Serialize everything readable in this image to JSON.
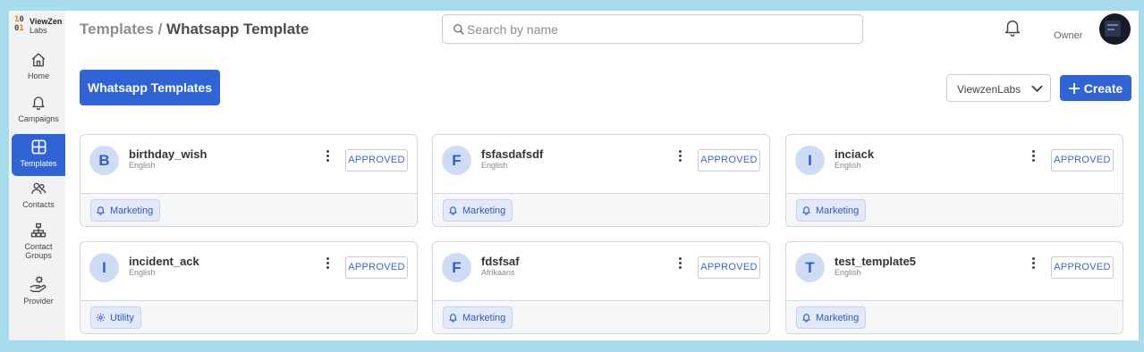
{
  "brand": {
    "name_line1": "ViewZen",
    "name_line2": "Labs"
  },
  "sidebar": {
    "items": [
      {
        "label": "Home",
        "icon": "home-icon"
      },
      {
        "label": "Campaigns",
        "icon": "bell-icon"
      },
      {
        "label": "Templates",
        "icon": "grid-icon",
        "active": true
      },
      {
        "label": "Contacts",
        "icon": "users-icon"
      },
      {
        "label": "Contact Groups",
        "icon": "hierarchy-icon"
      },
      {
        "label": "Provider",
        "icon": "hand-gear-icon"
      }
    ]
  },
  "header": {
    "breadcrumb_parent": "Templates",
    "breadcrumb_sep": "/",
    "breadcrumb_current": "Whatsapp Template",
    "search_placeholder": "Search by name",
    "user_role": "Owner"
  },
  "toolbar": {
    "whatsapp_templates_label": "Whatsapp Templates",
    "org_selected": "ViewzenLabs",
    "create_label": "Create"
  },
  "colors": {
    "accent": "#2f63d6",
    "status_text": "#3d66c8",
    "badge_bg": "#e2eaf9"
  },
  "templates": [
    {
      "initial": "B",
      "name": "birthday_wish",
      "language": "English",
      "status": "APPROVED",
      "category": "Marketing",
      "category_icon": "bell-icon"
    },
    {
      "initial": "F",
      "name": "fsfasdafsdf",
      "language": "English",
      "status": "APPROVED",
      "category": "Marketing",
      "category_icon": "bell-icon"
    },
    {
      "initial": "I",
      "name": "inciack",
      "language": "English",
      "status": "APPROVED",
      "category": "Marketing",
      "category_icon": "bell-icon"
    },
    {
      "initial": "I",
      "name": "incident_ack",
      "language": "English",
      "status": "APPROVED",
      "category": "Utility",
      "category_icon": "gear-icon"
    },
    {
      "initial": "F",
      "name": "fdsfsaf",
      "language": "Afrikaans",
      "status": "APPROVED",
      "category": "Marketing",
      "category_icon": "bell-icon"
    },
    {
      "initial": "T",
      "name": "test_template5",
      "language": "English",
      "status": "APPROVED",
      "category": "Marketing",
      "category_icon": "bell-icon"
    }
  ]
}
